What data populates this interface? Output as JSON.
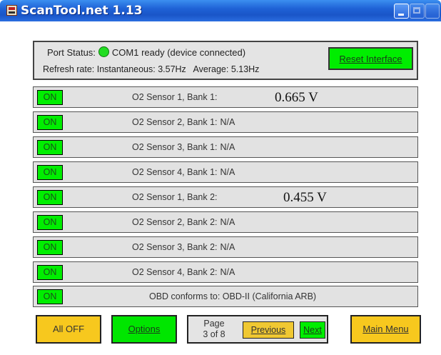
{
  "window": {
    "title": "ScanTool.net 1.13"
  },
  "status": {
    "port_prefix": "Port Status:",
    "port_text": "COM1 ready (device connected)",
    "led_color": "#22dd22",
    "refresh_text": "Refresh rate: Instantaneous: 3.57Hz   Average: 5.13Hz",
    "reset_label": "Reset Interface"
  },
  "sensors": [
    {
      "on_label": "ON",
      "label": "O2 Sensor 1, Bank 1:",
      "value": "",
      "reading": "0.665 V"
    },
    {
      "on_label": "ON",
      "label": "O2 Sensor 2, Bank 1:",
      "value": "N/A",
      "reading": ""
    },
    {
      "on_label": "ON",
      "label": "O2 Sensor 3, Bank 1:",
      "value": "N/A",
      "reading": ""
    },
    {
      "on_label": "ON",
      "label": "O2 Sensor 4, Bank 1:",
      "value": "N/A",
      "reading": ""
    },
    {
      "on_label": "ON",
      "label": "O2 Sensor 1, Bank 2:",
      "value": "",
      "reading": "0.455 V"
    },
    {
      "on_label": "ON",
      "label": "O2 Sensor 2, Bank 2:",
      "value": "N/A",
      "reading": ""
    },
    {
      "on_label": "ON",
      "label": "O2 Sensor 3, Bank 2:",
      "value": "N/A",
      "reading": ""
    },
    {
      "on_label": "ON",
      "label": "O2 Sensor 4, Bank 2:",
      "value": "N/A",
      "reading": ""
    }
  ],
  "obd": {
    "on_label": "ON",
    "label": "OBD conforms to: OBD-II (California ARB)"
  },
  "bottom": {
    "all_off": "All OFF",
    "options": "Options",
    "page_label": "Page",
    "page_count": "3 of 8",
    "previous": "Previous",
    "next": "Next",
    "main_menu": "Main Menu"
  },
  "colors": {
    "on_green": "#00ee00",
    "button_yellow": "#f7c81e",
    "panel_gray": "#e2e2e2",
    "title_blue": "#1f62d6"
  }
}
